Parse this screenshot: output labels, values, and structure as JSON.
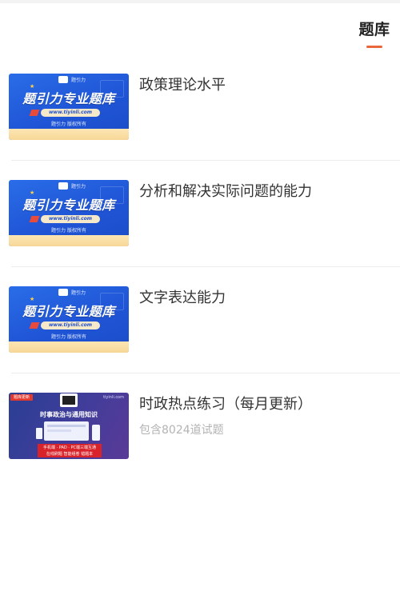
{
  "header": {
    "tab_label": "题库"
  },
  "items": [
    {
      "title": "政策理论水平",
      "subtitle": "",
      "thumb": {
        "logo_text": "题引力",
        "headline": "题引力专业题库",
        "url": "www.tiyinli.com",
        "tagline": "题引力 版权所有"
      }
    },
    {
      "title": "分析和解决实际问题的能力",
      "subtitle": "",
      "thumb": {
        "logo_text": "题引力",
        "headline": "题引力专业题库",
        "url": "www.tiyinli.com",
        "tagline": "题引力 版权所有"
      }
    },
    {
      "title": "文字表达能力",
      "subtitle": "",
      "thumb": {
        "logo_text": "题引力",
        "headline": "题引力专业题库",
        "url": "www.tiyinli.com",
        "tagline": "题引力 版权所有"
      }
    },
    {
      "title": "时政热点练习（每月更新）",
      "subtitle": "包含8024道试题",
      "thumb": {
        "corner_tag": "题库更新",
        "site": "tiyinli.com",
        "heading": "时事政治与通用知识",
        "line1": "手机端 · PAD · PC端三端互通",
        "line2": "在线刷题 智能组卷 错题本"
      }
    }
  ],
  "colors": {
    "accent": "#e8673d",
    "blue_thumb": "#1f55d6",
    "purple_thumb": "#3d3d9a"
  }
}
